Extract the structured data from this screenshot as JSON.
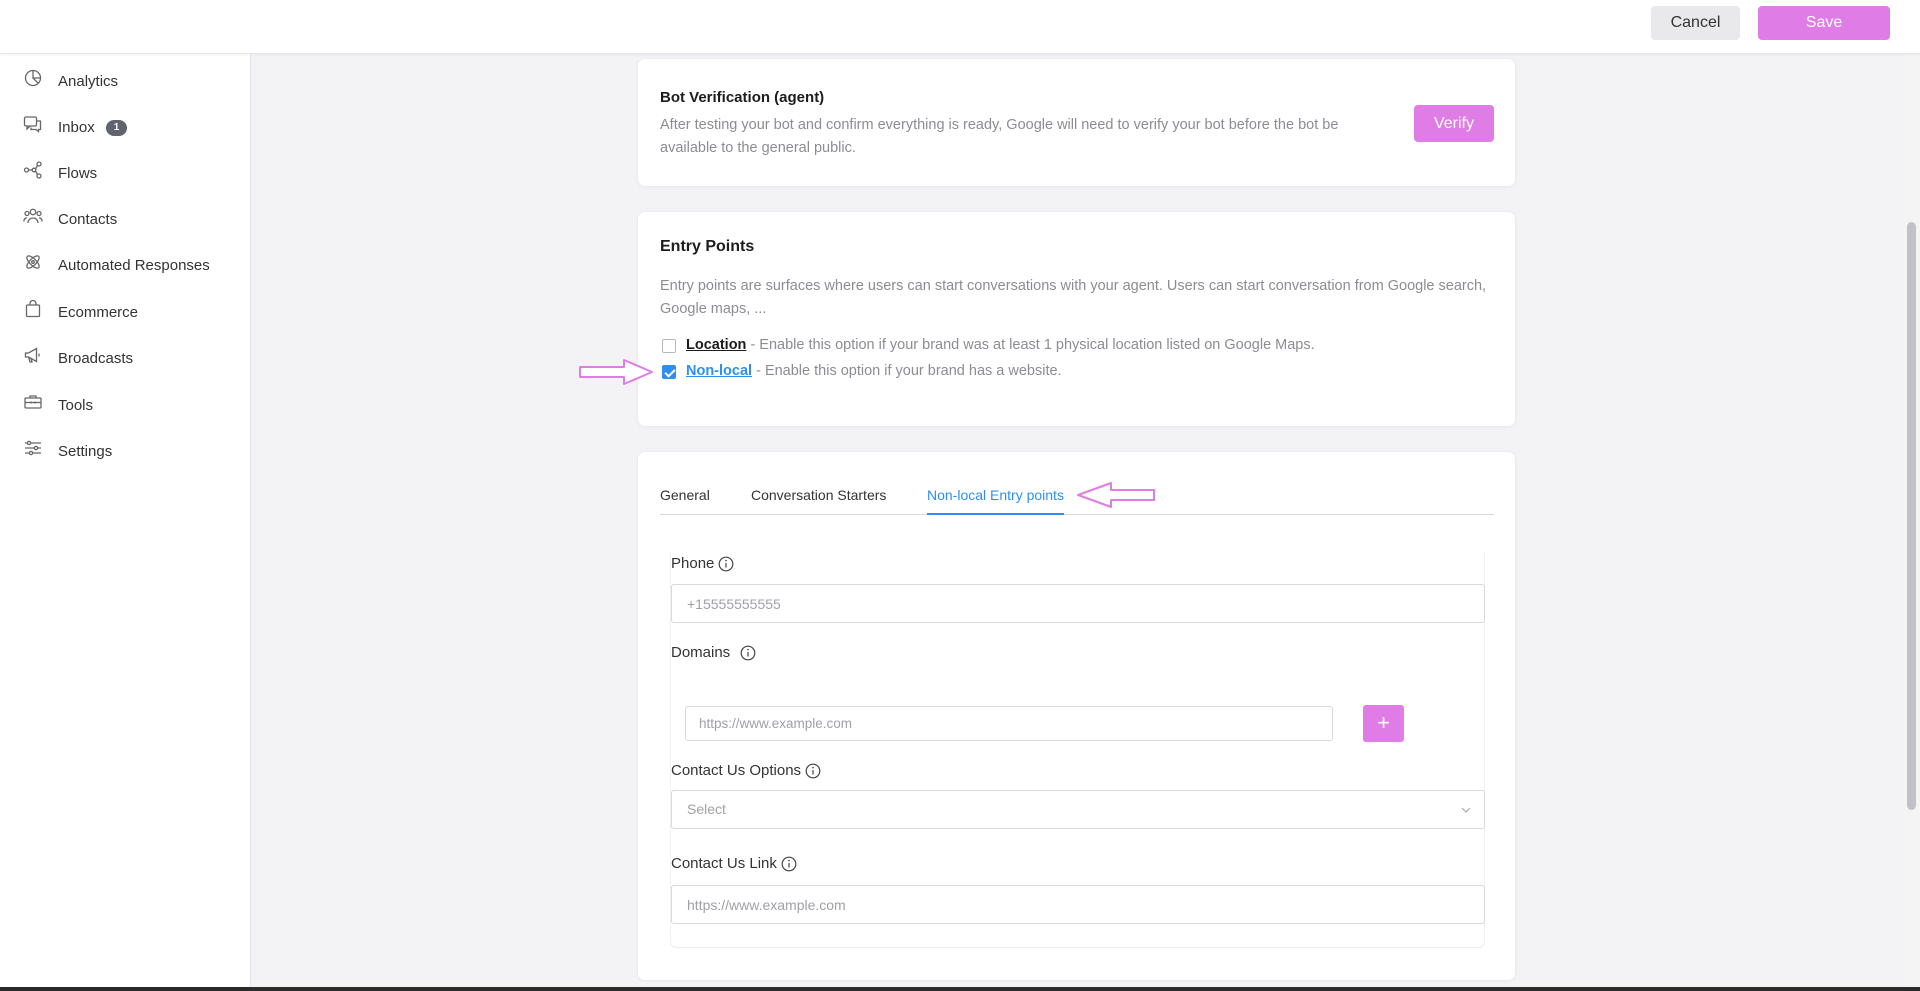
{
  "topbar": {
    "cancel_label": "Cancel",
    "save_label": "Save"
  },
  "sidebar": {
    "items": [
      {
        "label": "Analytics",
        "icon": "pie-chart-icon"
      },
      {
        "label": "Inbox",
        "icon": "chat-bubbles-icon",
        "badge": "1"
      },
      {
        "label": "Flows",
        "icon": "flow-nodes-icon"
      },
      {
        "label": "Contacts",
        "icon": "people-icon"
      },
      {
        "label": "Automated Responses",
        "icon": "atom-icon"
      },
      {
        "label": "Ecommerce",
        "icon": "shopping-bag-icon"
      },
      {
        "label": "Broadcasts",
        "icon": "megaphone-icon"
      },
      {
        "label": "Tools",
        "icon": "toolbox-icon"
      },
      {
        "label": "Settings",
        "icon": "sliders-icon"
      }
    ]
  },
  "bot_verification": {
    "title": "Bot Verification (agent)",
    "description": "After testing your bot and confirm everything is ready, Google will need to verify your bot before the bot be available to the general public.",
    "verify_label": "Verify"
  },
  "entry_points": {
    "title": "Entry Points",
    "description": "Entry points are surfaces where users can start conversations with your agent. Users can start conversation from Google search, Google maps, ...",
    "location": {
      "label": "Location",
      "text": " - Enable this option if your brand was at least 1 physical location listed on Google Maps.",
      "checked": false
    },
    "nonlocal": {
      "label": "Non-local",
      "text": " - Enable this option if your brand has a website.",
      "checked": true
    }
  },
  "tabs": {
    "items": [
      "General",
      "Conversation Starters",
      "Non-local Entry points"
    ],
    "active": "Non-local Entry points"
  },
  "form": {
    "phone": {
      "label": "Phone",
      "placeholder": "+15555555555"
    },
    "domains": {
      "label": "Domains",
      "placeholder": "https://www.example.com",
      "add_label": "+"
    },
    "contact_options": {
      "label": "Contact Us Options",
      "placeholder": "Select"
    },
    "contact_link": {
      "label": "Contact Us Link",
      "placeholder": "https://www.example.com"
    }
  },
  "colors": {
    "accent": "#e07ce6",
    "link_blue": "#2e8ff0",
    "annotation_arrow": "#e07ce6"
  }
}
